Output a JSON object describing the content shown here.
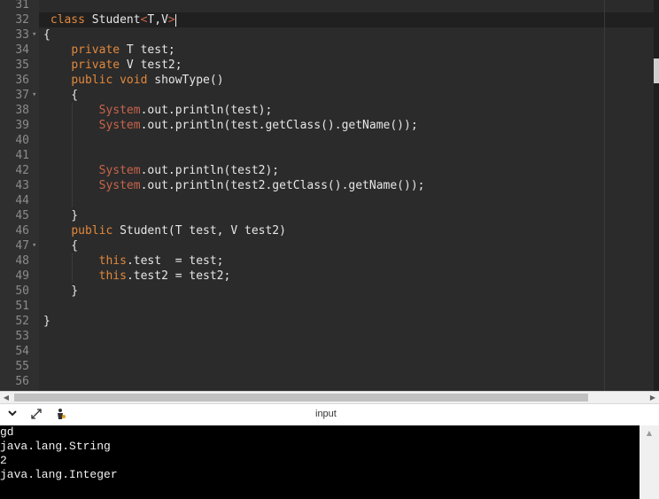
{
  "editor": {
    "lines": [
      {
        "n": "31",
        "fold": false,
        "tokens": []
      },
      {
        "n": "32",
        "fold": false,
        "active": true,
        "tokens": [
          {
            "t": " "
          },
          {
            "t": "class",
            "c": "kw"
          },
          {
            "t": " Student"
          },
          {
            "t": "<",
            "c": "cls"
          },
          {
            "t": "T,V"
          },
          {
            "t": ">",
            "c": "cls"
          }
        ]
      },
      {
        "n": "33",
        "fold": true,
        "tokens": [
          {
            "t": "{"
          }
        ]
      },
      {
        "n": "34",
        "fold": false,
        "tokens": [
          {
            "t": "    "
          },
          {
            "t": "private",
            "c": "kw"
          },
          {
            "t": " T test;"
          }
        ]
      },
      {
        "n": "35",
        "fold": false,
        "tokens": [
          {
            "t": "    "
          },
          {
            "t": "private",
            "c": "kw"
          },
          {
            "t": " V test2;"
          }
        ]
      },
      {
        "n": "36",
        "fold": false,
        "tokens": [
          {
            "t": "    "
          },
          {
            "t": "public",
            "c": "kw"
          },
          {
            "t": " "
          },
          {
            "t": "void",
            "c": "kw"
          },
          {
            "t": " showType()"
          }
        ]
      },
      {
        "n": "37",
        "fold": true,
        "tokens": [
          {
            "t": "    {"
          }
        ]
      },
      {
        "n": "38",
        "fold": false,
        "tokens": [
          {
            "t": "        "
          },
          {
            "t": "System",
            "c": "cls"
          },
          {
            "t": ".out.println(test);"
          }
        ]
      },
      {
        "n": "39",
        "fold": false,
        "tokens": [
          {
            "t": "        "
          },
          {
            "t": "System",
            "c": "cls"
          },
          {
            "t": ".out.println(test.getClass().getName());"
          }
        ]
      },
      {
        "n": "40",
        "fold": false,
        "tokens": []
      },
      {
        "n": "41",
        "fold": false,
        "tokens": []
      },
      {
        "n": "42",
        "fold": false,
        "tokens": [
          {
            "t": "        "
          },
          {
            "t": "System",
            "c": "cls"
          },
          {
            "t": ".out.println(test2);"
          }
        ]
      },
      {
        "n": "43",
        "fold": false,
        "tokens": [
          {
            "t": "        "
          },
          {
            "t": "System",
            "c": "cls"
          },
          {
            "t": ".out.println(test2.getClass().getName());"
          }
        ]
      },
      {
        "n": "44",
        "fold": false,
        "tokens": []
      },
      {
        "n": "45",
        "fold": false,
        "tokens": [
          {
            "t": "    }"
          }
        ]
      },
      {
        "n": "46",
        "fold": false,
        "tokens": [
          {
            "t": "    "
          },
          {
            "t": "public",
            "c": "kw"
          },
          {
            "t": " Student(T test, V test2)"
          }
        ]
      },
      {
        "n": "47",
        "fold": true,
        "tokens": [
          {
            "t": "    {"
          }
        ]
      },
      {
        "n": "48",
        "fold": false,
        "tokens": [
          {
            "t": "        "
          },
          {
            "t": "this",
            "c": "kw"
          },
          {
            "t": ".test  = test;"
          }
        ]
      },
      {
        "n": "49",
        "fold": false,
        "tokens": [
          {
            "t": "        "
          },
          {
            "t": "this",
            "c": "kw"
          },
          {
            "t": ".test2 = test2;"
          }
        ]
      },
      {
        "n": "50",
        "fold": false,
        "tokens": [
          {
            "t": "    }"
          }
        ]
      },
      {
        "n": "51",
        "fold": false,
        "tokens": []
      },
      {
        "n": "52",
        "fold": false,
        "tokens": [
          {
            "t": "}"
          }
        ]
      },
      {
        "n": "53",
        "fold": false,
        "tokens": []
      },
      {
        "n": "54",
        "fold": false,
        "tokens": []
      },
      {
        "n": "55",
        "fold": false,
        "tokens": []
      },
      {
        "n": "56",
        "fold": false,
        "tokens": []
      }
    ]
  },
  "panel": {
    "title": "input",
    "icons": [
      "chevron-down-icon",
      "expand-icon",
      "run-person-icon"
    ]
  },
  "console": {
    "lines": [
      "gd",
      "java.lang.String",
      "2",
      "java.lang.Integer"
    ]
  },
  "colors": {
    "keyword": "#e2893c",
    "class": "#c9644b",
    "text": "#e6e6e6",
    "background": "#2b2b2b"
  }
}
